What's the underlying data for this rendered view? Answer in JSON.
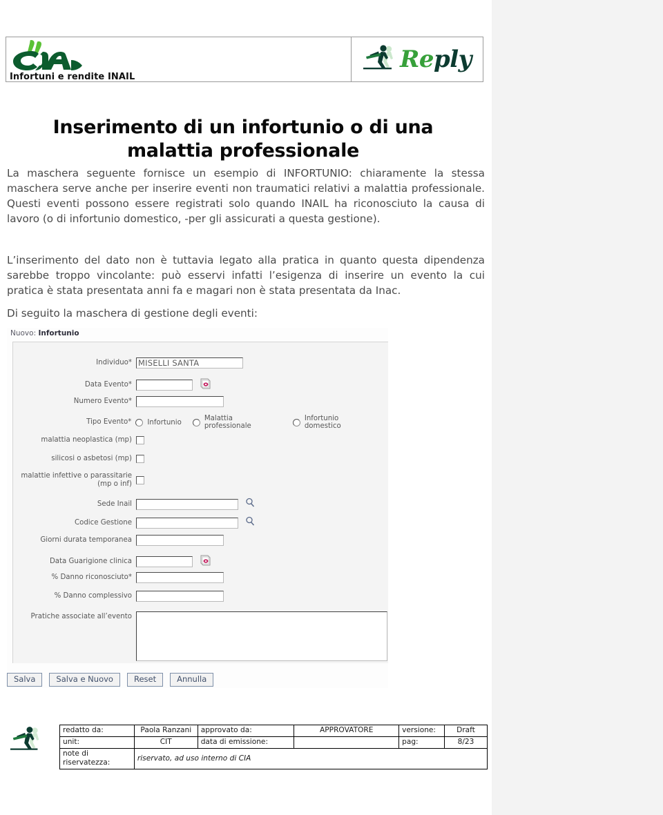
{
  "header": {
    "logo_left": {
      "name": "cia-logo",
      "subtitle": "Infortuni e rendite INAIL"
    },
    "logo_right": {
      "name": "reply-logo",
      "text_green": "Re",
      "text_dark": "ply"
    }
  },
  "title": "Inserimento di un infortunio o di una malattia professionale",
  "paragraphs": {
    "p1": "La maschera seguente fornisce un esempio di INFORTUNIO: chiaramente la stessa maschera serve anche per inserire eventi non traumatici relativi a malattia professionale. Questi eventi possono essere registrati solo quando INAIL  ha riconosciuto la causa di lavoro (o di infortunio domestico, -per gli assicurati a questa gestione).",
    "p2": "L’inserimento del dato non è tuttavia legato alla pratica in quanto questa dipendenza sarebbe troppo vincolante: può esservi infatti l’esigenza di inserire un evento la cui pratica è stata presentata anni fa e magari non è stata presentata da Inac.",
    "p3": "Di seguito la maschera di gestione degli eventi:"
  },
  "form": {
    "screen_title_prefix": "Nuovo:",
    "screen_title_value": "Infortunio",
    "fields": {
      "individuo": {
        "label": "Individuo",
        "required": true,
        "value": "MISELLI SANTA"
      },
      "data_evento": {
        "label": "Data Evento",
        "required": true,
        "value": "",
        "icon": "calendar-icon"
      },
      "numero_evento": {
        "label": "Numero Evento",
        "required": true,
        "value": ""
      },
      "tipo_evento": {
        "label": "Tipo Evento",
        "required": true,
        "options": [
          "Infortunio",
          "Malattia professionale",
          "Infortunio domestico"
        ],
        "selected": ""
      },
      "malattia_neoplastica": {
        "label": "malattia neoplastica (mp)",
        "checked": false
      },
      "silicosi": {
        "label": "silicosi o asbetosi (mp)",
        "checked": false
      },
      "malattie_infettive": {
        "label": "malattie infettive o parassitarie (mp o inf)",
        "checked": false
      },
      "sede_inail": {
        "label": "Sede Inail",
        "value": "",
        "icon": "magnifier-icon"
      },
      "codice_gestione": {
        "label": "Codice Gestione",
        "value": "",
        "icon": "magnifier-icon"
      },
      "giorni_durata": {
        "label": "Giorni durata temporanea",
        "value": ""
      },
      "data_guarigione": {
        "label": "Data Guarigione clinica",
        "value": "",
        "icon": "calendar-icon"
      },
      "danno_riconosciuto": {
        "label": "% Danno riconosciuto",
        "required": true,
        "value": ""
      },
      "danno_complessivo": {
        "label": "% Danno complessivo",
        "value": ""
      },
      "pratiche_associate": {
        "label": "Pratiche associate all’evento",
        "value": ""
      }
    },
    "buttons": [
      "Salva",
      "Salva e Nuovo",
      "Reset",
      "Annulla"
    ]
  },
  "footer": {
    "rows": [
      {
        "k": "redatto da:",
        "v": "Paola Ranzani",
        "k2": "approvato da:",
        "v2": "APPROVATORE",
        "k3": "versione:",
        "v3": "Draft"
      },
      {
        "k": "unit:",
        "v": "CIT",
        "k2": "data di emissione:",
        "v2": "",
        "k3": "pag:",
        "v3": "8/23"
      }
    ],
    "note_key": "note di riservatezza:",
    "note_value": "riservato, ad uso interno di CIA"
  },
  "colors": {
    "brand_green_dark": "#0c3b30",
    "brand_green": "#37a03a",
    "cia_green": "#0c5c2e",
    "page_bg": "#ffffff",
    "outside_bg": "#f3f3f3"
  }
}
